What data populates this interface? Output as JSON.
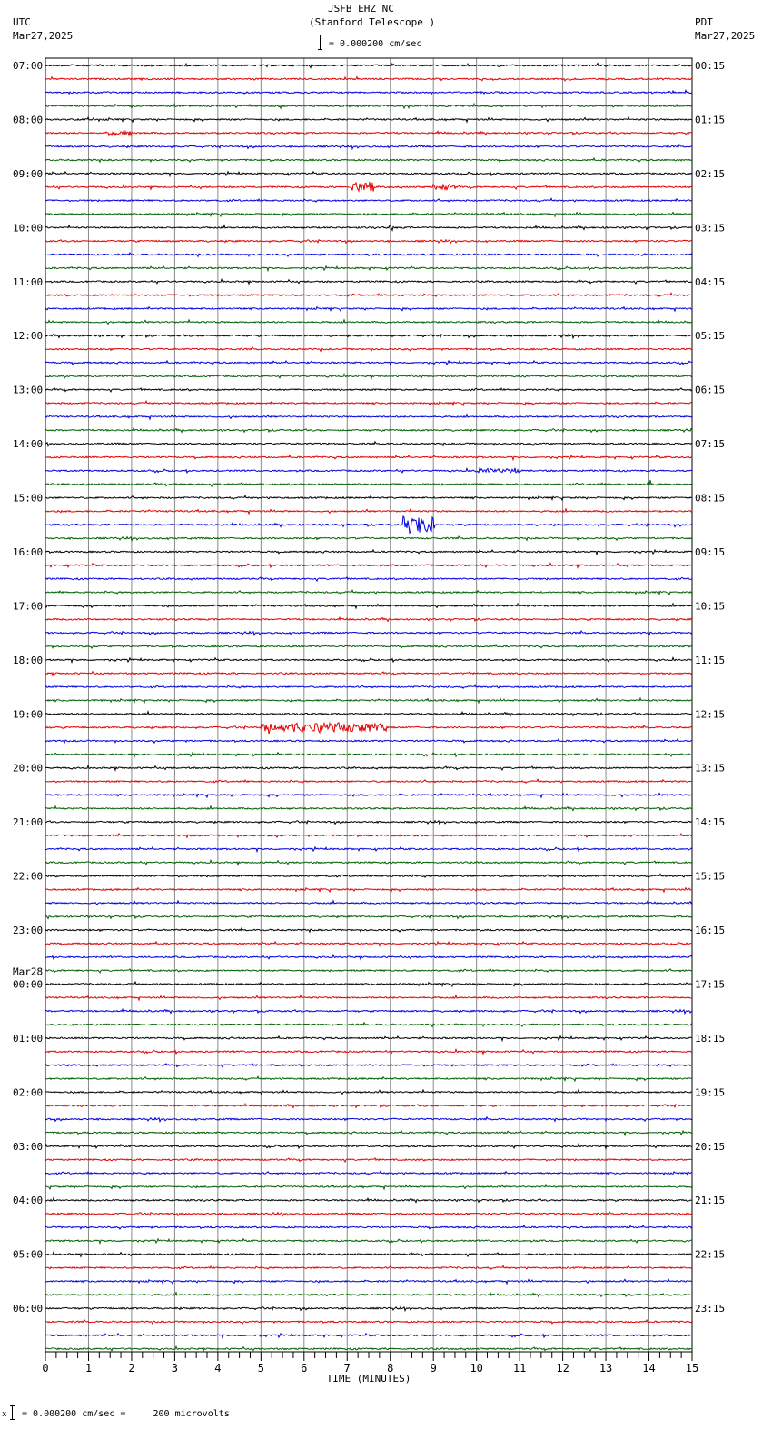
{
  "header": {
    "title": "JSFB EHZ NC",
    "subtitle": "(Stanford Telescope )",
    "left_tz": "UTC",
    "left_date": "Mar27,2025",
    "right_tz": "PDT",
    "right_date": "Mar27,2025",
    "scale_label": "= 0.000200 cm/sec"
  },
  "footer": {
    "scale_note": "= 0.000200 cm/sec =     200 microvolts",
    "marker": "x"
  },
  "chart_data": {
    "type": "line",
    "title": "JSFB EHZ NC (Stanford Telescope )",
    "xlabel": "TIME (MINUTES)",
    "xlim": [
      0,
      15
    ],
    "x_ticks": [
      "0",
      "1",
      "2",
      "3",
      "4",
      "5",
      "6",
      "7",
      "8",
      "9",
      "10",
      "11",
      "12",
      "13",
      "14",
      "15"
    ],
    "traces_per_hour": 4,
    "trace_colors": [
      "#000000",
      "#e00000",
      "#0000e0",
      "#006000"
    ],
    "left_labels": [
      "07:00",
      "08:00",
      "09:00",
      "10:00",
      "11:00",
      "12:00",
      "13:00",
      "14:00",
      "15:00",
      "16:00",
      "17:00",
      "18:00",
      "19:00",
      "20:00",
      "21:00",
      "22:00",
      "23:00",
      "00:00",
      "01:00",
      "02:00",
      "03:00",
      "04:00",
      "05:00",
      "06:00"
    ],
    "date_change_label": "Mar28",
    "date_change_index": 17,
    "right_labels": [
      "00:15",
      "01:15",
      "02:15",
      "03:15",
      "04:15",
      "05:15",
      "06:15",
      "07:15",
      "08:15",
      "09:15",
      "10:15",
      "11:15",
      "12:15",
      "13:15",
      "14:15",
      "15:15",
      "16:15",
      "17:15",
      "18:15",
      "19:15",
      "20:15",
      "21:15",
      "22:15",
      "23:15"
    ],
    "events": [
      {
        "trace_index": 5,
        "start_min": 1.4,
        "end_min": 2.0,
        "amplitude": 2.5
      },
      {
        "trace_index": 9,
        "start_min": 7.1,
        "end_min": 7.6,
        "amplitude": 5
      },
      {
        "trace_index": 9,
        "start_min": 9.0,
        "end_min": 9.5,
        "amplitude": 3
      },
      {
        "trace_index": 12,
        "start_min": 8.0,
        "end_min": 8.05,
        "amplitude": 3
      },
      {
        "trace_index": 30,
        "start_min": 10.0,
        "end_min": 11.0,
        "amplitude": 2
      },
      {
        "trace_index": 31,
        "start_min": 14.0,
        "end_min": 14.05,
        "amplitude": 7
      },
      {
        "trace_index": 34,
        "start_min": 8.3,
        "end_min": 9.0,
        "amplitude": 9
      },
      {
        "trace_index": 49,
        "start_min": 5.0,
        "end_min": 7.9,
        "amplitude": 5
      }
    ]
  }
}
